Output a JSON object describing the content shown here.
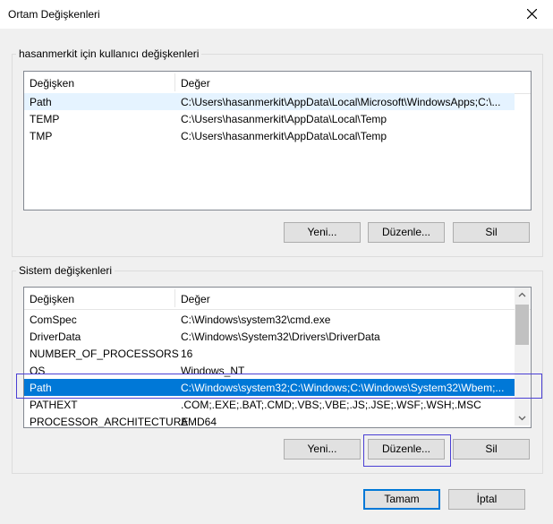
{
  "window": {
    "title": "Ortam Değişkenleri"
  },
  "user_group": {
    "legend": "hasanmerkit için kullanıcı değişkenleri",
    "columns": [
      "Değişken",
      "Değer"
    ],
    "rows": [
      {
        "name": "Path",
        "value": "C:\\Users\\hasanmerkit\\AppData\\Local\\Microsoft\\WindowsApps;C:\\..."
      },
      {
        "name": "TEMP",
        "value": "C:\\Users\\hasanmerkit\\AppData\\Local\\Temp"
      },
      {
        "name": "TMP",
        "value": "C:\\Users\\hasanmerkit\\AppData\\Local\\Temp"
      }
    ],
    "buttons": {
      "new": "Yeni...",
      "edit": "Düzenle...",
      "delete": "Sil"
    }
  },
  "system_group": {
    "legend": "Sistem değişkenleri",
    "columns": [
      "Değişken",
      "Değer"
    ],
    "rows": [
      {
        "name": "ComSpec",
        "value": "C:\\Windows\\system32\\cmd.exe"
      },
      {
        "name": "DriverData",
        "value": "C:\\Windows\\System32\\Drivers\\DriverData"
      },
      {
        "name": "NUMBER_OF_PROCESSORS",
        "value": "16"
      },
      {
        "name": "OS",
        "value": "Windows_NT"
      },
      {
        "name": "Path",
        "value": "C:\\Windows\\system32;C:\\Windows;C:\\Windows\\System32\\Wbem;..."
      },
      {
        "name": "PATHEXT",
        "value": ".COM;.EXE;.BAT;.CMD;.VBS;.VBE;.JS;.JSE;.WSF;.WSH;.MSC"
      },
      {
        "name": "PROCESSOR_ARCHITECTURE",
        "value": "AMD64"
      }
    ],
    "selected_row": "Path",
    "buttons": {
      "new": "Yeni...",
      "edit": "Düzenle...",
      "delete": "Sil"
    }
  },
  "footer": {
    "ok": "Tamam",
    "cancel": "İptal"
  },
  "colors": {
    "selection": "#0078d7",
    "highlight": "#e5f3ff",
    "annotation": "#4a3fd4"
  },
  "icons": [
    "close-icon",
    "scroll-up-icon",
    "scroll-down-icon"
  ]
}
